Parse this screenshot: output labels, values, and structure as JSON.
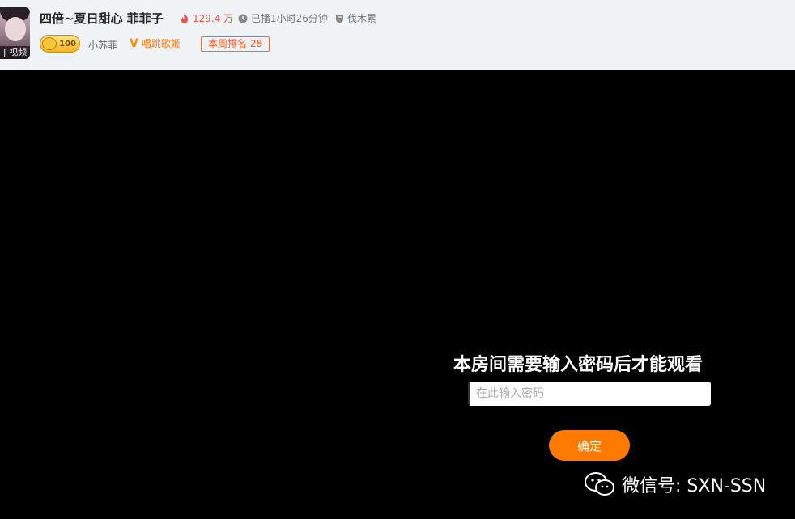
{
  "header": {
    "avatar_tag": "| 视频",
    "title": "四倍~夏日甜心 菲菲子",
    "hot": "129.4 万",
    "live_time": "已播1小时26分钟",
    "category": "伐木累",
    "level": "100",
    "nickname": "小苏菲",
    "vcategory": "唱跳歌姬",
    "rank": "本周排名 28"
  },
  "lock": {
    "title": "本房间需要输入密码后才能观看",
    "placeholder": "在此输入密码",
    "confirm": "确定"
  },
  "watermark": "微信号: SXN-SSN"
}
